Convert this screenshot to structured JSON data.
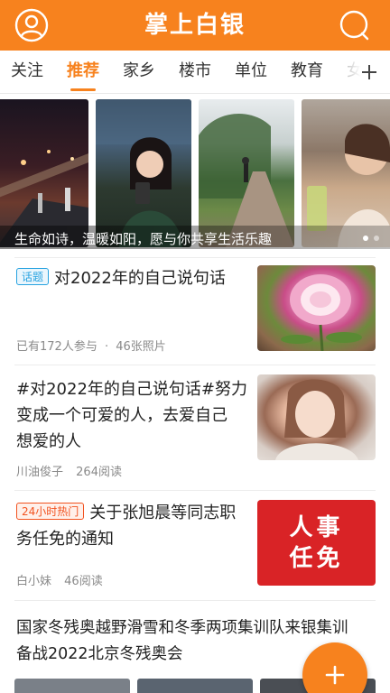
{
  "header": {
    "title": "掌上白银",
    "profile_icon": "user-circle-icon",
    "search_icon": "search-icon",
    "bg_color": "#f7821e"
  },
  "tabs": {
    "items": [
      "关注",
      "推荐",
      "家乡",
      "楼市",
      "单位",
      "教育",
      "女"
    ],
    "active_index": 1,
    "more_icon": "plus-icon"
  },
  "carousel": {
    "caption": "生命如诗，温暖如阳，愿与你共享生活乐趣",
    "slides": [
      "夜景桥",
      "女孩看手机",
      "林间小道",
      "咖啡店女孩"
    ],
    "active_dot": 0,
    "dot_count": 2
  },
  "feed": [
    {
      "badge": "话题",
      "title": "对2022年的自己说句话",
      "meta1": "已有172人参与",
      "separator": "·",
      "meta2": "46张照片",
      "thumb": "rose-photo"
    },
    {
      "title_lines": [
        "#对2022年的自己说句话#努力",
        "变成一个可爱的人，去爱自己",
        "想爱的人"
      ],
      "author": "川油俊子",
      "reads": "264阅读",
      "thumb": "portrait-photo"
    },
    {
      "badge": "24小时热门",
      "title_line1": "关于张旭晨等同志职",
      "title_line2": "务任免的通知",
      "author": "白小妹",
      "reads": "46阅读",
      "thumb_text_1": "人事",
      "thumb_text_2": "任免"
    },
    {
      "title_lines": [
        "国家冬残奥越野滑雪和冬季两项集训队来银集训",
        "备战2022北京冬残奥会"
      ]
    }
  ],
  "fab": {
    "icon": "plus-icon",
    "label": "+"
  },
  "colors": {
    "accent": "#f7821e",
    "topic": "#27a2e0",
    "hot": "#f2521f",
    "renshi_red": "#d92326"
  }
}
